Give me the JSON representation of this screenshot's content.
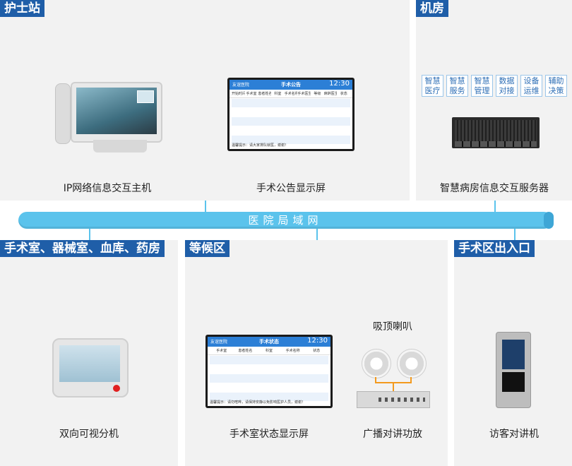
{
  "sections": {
    "nurse_station": "护士站",
    "server_room": "机房",
    "or_rooms": "手术室、器械室、血库、药房",
    "waiting_area": "等候区",
    "or_entrance": "手术区出入口"
  },
  "network": {
    "label": "医院局域网"
  },
  "devices": {
    "ip_host": "IP网络信息交互主机",
    "announcement_screen": "手术公告显示屏",
    "server": "智慧病房信息交互服务器",
    "bedside_unit": "双向可视分机",
    "status_screen": "手术室状态显示屏",
    "ceiling_speaker": "吸顶喇叭",
    "pa_amplifier": "广播对讲功放",
    "visitor_intercom": "访客对讲机"
  },
  "server_functions": [
    {
      "l1": "智慧",
      "l2": "医疗"
    },
    {
      "l1": "智慧",
      "l2": "服务"
    },
    {
      "l1": "智慧",
      "l2": "管理"
    },
    {
      "l1": "数据",
      "l2": "对接"
    },
    {
      "l1": "设备",
      "l2": "运维"
    },
    {
      "l1": "辅助",
      "l2": "决策"
    }
  ],
  "announcement": {
    "brand": "友谊医院",
    "title": "手术公告",
    "time": "12:30",
    "columns": [
      "开始时间",
      "手术室",
      "患者姓名",
      "科室",
      "手术名称",
      "手术医生",
      "等级",
      "麻醉医生",
      "状态"
    ],
    "footer": "温馨提示：请大家排队就医，谢谢！"
  },
  "status_board": {
    "brand": "友谊医院",
    "title": "手术状态",
    "time": "12:30",
    "columns": [
      "手术室",
      "患者姓名",
      "科室",
      "手术名称",
      "状态"
    ],
    "footer": "温馨提示：请勿喧哗，请保持安静以免影响医护人员，谢谢！"
  },
  "colors": {
    "tag_bg": "#1f5ea8",
    "bus": "#5bc3ec",
    "panel": "#f2f2f2",
    "wire": "#f39a1e"
  }
}
